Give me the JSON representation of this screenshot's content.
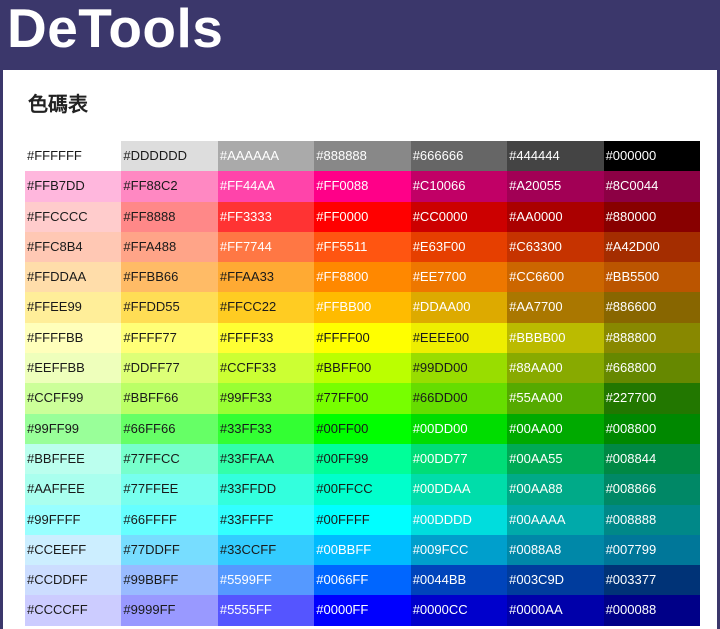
{
  "header": {
    "logo_text": "DeTools",
    "brand_color": "#3b376b"
  },
  "page": {
    "title": "色碼表"
  },
  "palette": {
    "rows": [
      {
        "cells": [
          {
            "hex": "#FFFFFF",
            "ink": "#1a1a1a"
          },
          {
            "hex": "#DDDDDD",
            "ink": "#1a1a1a"
          },
          {
            "hex": "#AAAAAA",
            "ink": "#ffffff"
          },
          {
            "hex": "#888888",
            "ink": "#ffffff"
          },
          {
            "hex": "#666666",
            "ink": "#ffffff"
          },
          {
            "hex": "#444444",
            "ink": "#ffffff"
          },
          {
            "hex": "#000000",
            "ink": "#ffffff"
          }
        ]
      },
      {
        "cells": [
          {
            "hex": "#FFB7DD",
            "ink": "#1a1a1a"
          },
          {
            "hex": "#FF88C2",
            "ink": "#1a1a1a"
          },
          {
            "hex": "#FF44AA",
            "ink": "#ffffff"
          },
          {
            "hex": "#FF0088",
            "ink": "#ffffff"
          },
          {
            "hex": "#C10066",
            "ink": "#ffffff"
          },
          {
            "hex": "#A20055",
            "ink": "#ffffff"
          },
          {
            "hex": "#8C0044",
            "ink": "#ffffff"
          }
        ]
      },
      {
        "cells": [
          {
            "hex": "#FFCCCC",
            "ink": "#1a1a1a"
          },
          {
            "hex": "#FF8888",
            "ink": "#1a1a1a"
          },
          {
            "hex": "#FF3333",
            "ink": "#ffffff"
          },
          {
            "hex": "#FF0000",
            "ink": "#ffffff"
          },
          {
            "hex": "#CC0000",
            "ink": "#ffffff"
          },
          {
            "hex": "#AA0000",
            "ink": "#ffffff"
          },
          {
            "hex": "#880000",
            "ink": "#ffffff"
          }
        ]
      },
      {
        "cells": [
          {
            "hex": "#FFC8B4",
            "ink": "#1a1a1a"
          },
          {
            "hex": "#FFA488",
            "ink": "#1a1a1a"
          },
          {
            "hex": "#FF7744",
            "ink": "#ffffff"
          },
          {
            "hex": "#FF5511",
            "ink": "#ffffff"
          },
          {
            "hex": "#E63F00",
            "ink": "#ffffff"
          },
          {
            "hex": "#C63300",
            "ink": "#ffffff"
          },
          {
            "hex": "#A42D00",
            "ink": "#ffffff"
          }
        ]
      },
      {
        "cells": [
          {
            "hex": "#FFDDAA",
            "ink": "#1a1a1a"
          },
          {
            "hex": "#FFBB66",
            "ink": "#1a1a1a"
          },
          {
            "hex": "#FFAA33",
            "ink": "#1a1a1a"
          },
          {
            "hex": "#FF8800",
            "ink": "#ffffff"
          },
          {
            "hex": "#EE7700",
            "ink": "#ffffff"
          },
          {
            "hex": "#CC6600",
            "ink": "#ffffff"
          },
          {
            "hex": "#BB5500",
            "ink": "#ffffff"
          }
        ]
      },
      {
        "cells": [
          {
            "hex": "#FFEE99",
            "ink": "#1a1a1a"
          },
          {
            "hex": "#FFDD55",
            "ink": "#1a1a1a"
          },
          {
            "hex": "#FFCC22",
            "ink": "#1a1a1a"
          },
          {
            "hex": "#FFBB00",
            "ink": "#ffffff"
          },
          {
            "hex": "#DDAA00",
            "ink": "#ffffff"
          },
          {
            "hex": "#AA7700",
            "ink": "#ffffff"
          },
          {
            "hex": "#886600",
            "ink": "#ffffff"
          }
        ]
      },
      {
        "cells": [
          {
            "hex": "#FFFFBB",
            "ink": "#1a1a1a"
          },
          {
            "hex": "#FFFF77",
            "ink": "#1a1a1a"
          },
          {
            "hex": "#FFFF33",
            "ink": "#1a1a1a"
          },
          {
            "hex": "#FFFF00",
            "ink": "#1a1a1a"
          },
          {
            "hex": "#EEEE00",
            "ink": "#1a1a1a"
          },
          {
            "hex": "#BBBB00",
            "ink": "#ffffff"
          },
          {
            "hex": "#888800",
            "ink": "#ffffff"
          }
        ]
      },
      {
        "cells": [
          {
            "hex": "#EEFFBB",
            "ink": "#1a1a1a"
          },
          {
            "hex": "#DDFF77",
            "ink": "#1a1a1a"
          },
          {
            "hex": "#CCFF33",
            "ink": "#1a1a1a"
          },
          {
            "hex": "#BBFF00",
            "ink": "#1a1a1a"
          },
          {
            "hex": "#99DD00",
            "ink": "#1a1a1a"
          },
          {
            "hex": "#88AA00",
            "ink": "#ffffff"
          },
          {
            "hex": "#668800",
            "ink": "#ffffff"
          }
        ]
      },
      {
        "cells": [
          {
            "hex": "#CCFF99",
            "ink": "#1a1a1a"
          },
          {
            "hex": "#BBFF66",
            "ink": "#1a1a1a"
          },
          {
            "hex": "#99FF33",
            "ink": "#1a1a1a"
          },
          {
            "hex": "#77FF00",
            "ink": "#1a1a1a"
          },
          {
            "hex": "#66DD00",
            "ink": "#1a1a1a"
          },
          {
            "hex": "#55AA00",
            "ink": "#ffffff"
          },
          {
            "hex": "#227700",
            "ink": "#ffffff"
          }
        ]
      },
      {
        "cells": [
          {
            "hex": "#99FF99",
            "ink": "#1a1a1a"
          },
          {
            "hex": "#66FF66",
            "ink": "#1a1a1a"
          },
          {
            "hex": "#33FF33",
            "ink": "#1a1a1a"
          },
          {
            "hex": "#00FF00",
            "ink": "#1a1a1a"
          },
          {
            "hex": "#00DD00",
            "ink": "#ffffff"
          },
          {
            "hex": "#00AA00",
            "ink": "#ffffff"
          },
          {
            "hex": "#008800",
            "ink": "#ffffff"
          }
        ]
      },
      {
        "cells": [
          {
            "hex": "#BBFFEE",
            "ink": "#1a1a1a"
          },
          {
            "hex": "#77FFCC",
            "ink": "#1a1a1a"
          },
          {
            "hex": "#33FFAA",
            "ink": "#1a1a1a"
          },
          {
            "hex": "#00FF99",
            "ink": "#1a1a1a"
          },
          {
            "hex": "#00DD77",
            "ink": "#ffffff"
          },
          {
            "hex": "#00AA55",
            "ink": "#ffffff"
          },
          {
            "hex": "#008844",
            "ink": "#ffffff"
          }
        ]
      },
      {
        "cells": [
          {
            "hex": "#AAFFEE",
            "ink": "#1a1a1a"
          },
          {
            "hex": "#77FFEE",
            "ink": "#1a1a1a"
          },
          {
            "hex": "#33FFDD",
            "ink": "#1a1a1a"
          },
          {
            "hex": "#00FFCC",
            "ink": "#1a1a1a"
          },
          {
            "hex": "#00DDAA",
            "ink": "#ffffff"
          },
          {
            "hex": "#00AA88",
            "ink": "#ffffff"
          },
          {
            "hex": "#008866",
            "ink": "#ffffff"
          }
        ]
      },
      {
        "cells": [
          {
            "hex": "#99FFFF",
            "ink": "#1a1a1a"
          },
          {
            "hex": "#66FFFF",
            "ink": "#1a1a1a"
          },
          {
            "hex": "#33FFFF",
            "ink": "#1a1a1a"
          },
          {
            "hex": "#00FFFF",
            "ink": "#1a1a1a"
          },
          {
            "hex": "#00DDDD",
            "ink": "#ffffff"
          },
          {
            "hex": "#00AAAA",
            "ink": "#ffffff"
          },
          {
            "hex": "#008888",
            "ink": "#ffffff"
          }
        ]
      },
      {
        "cells": [
          {
            "hex": "#CCEEFF",
            "ink": "#1a1a1a"
          },
          {
            "hex": "#77DDFF",
            "ink": "#1a1a1a"
          },
          {
            "hex": "#33CCFF",
            "ink": "#1a1a1a"
          },
          {
            "hex": "#00BBFF",
            "ink": "#ffffff"
          },
          {
            "hex": "#009FCC",
            "ink": "#ffffff"
          },
          {
            "hex": "#0088A8",
            "ink": "#ffffff"
          },
          {
            "hex": "#007799",
            "ink": "#ffffff"
          }
        ]
      },
      {
        "cells": [
          {
            "hex": "#CCDDFF",
            "ink": "#1a1a1a"
          },
          {
            "hex": "#99BBFF",
            "ink": "#1a1a1a"
          },
          {
            "hex": "#5599FF",
            "ink": "#ffffff"
          },
          {
            "hex": "#0066FF",
            "ink": "#ffffff"
          },
          {
            "hex": "#0044BB",
            "ink": "#ffffff"
          },
          {
            "hex": "#003C9D",
            "ink": "#ffffff"
          },
          {
            "hex": "#003377",
            "ink": "#ffffff"
          }
        ]
      },
      {
        "cells": [
          {
            "hex": "#CCCCFF",
            "ink": "#1a1a1a"
          },
          {
            "hex": "#9999FF",
            "ink": "#1a1a1a"
          },
          {
            "hex": "#5555FF",
            "ink": "#ffffff"
          },
          {
            "hex": "#0000FF",
            "ink": "#ffffff"
          },
          {
            "hex": "#0000CC",
            "ink": "#ffffff"
          },
          {
            "hex": "#0000AA",
            "ink": "#ffffff"
          },
          {
            "hex": "#000088",
            "ink": "#ffffff"
          }
        ]
      }
    ]
  }
}
